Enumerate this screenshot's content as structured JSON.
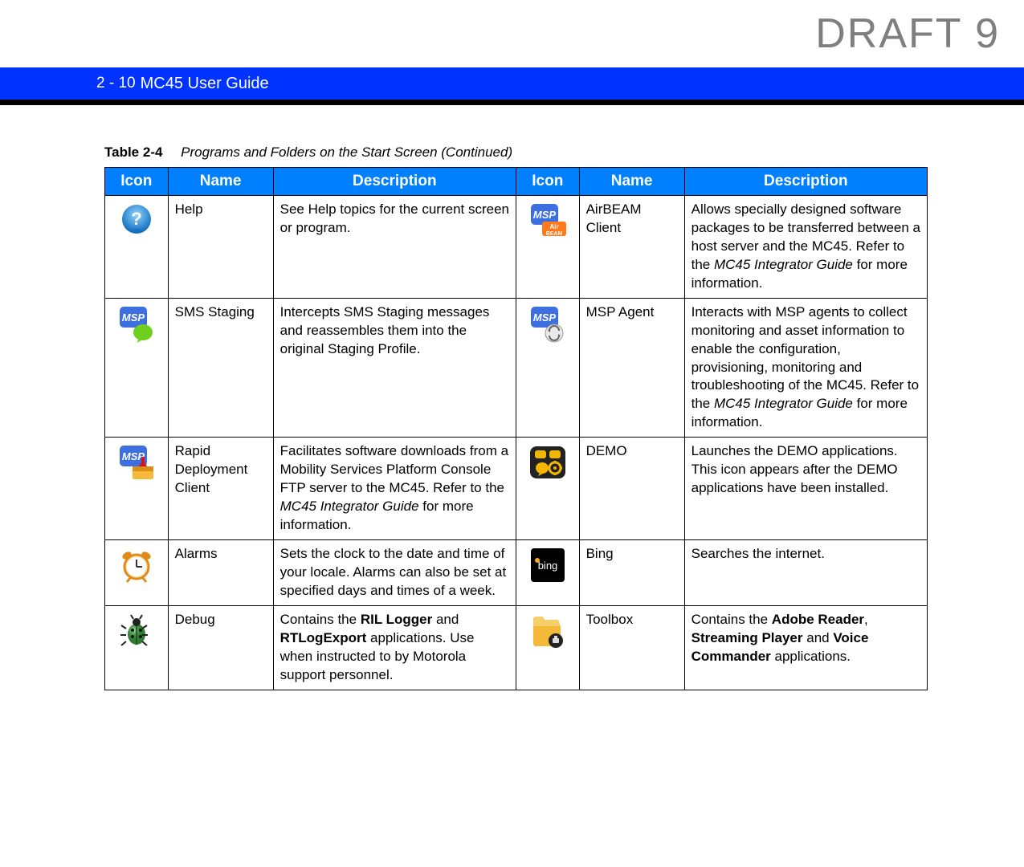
{
  "watermark": "DRAFT 9",
  "header": {
    "page_num": "2 - 10",
    "title": "MC45 User Guide"
  },
  "table_caption": {
    "label": "Table 2-4",
    "text": "Programs and Folders on the Start Screen (Continued)"
  },
  "th": {
    "icon": "Icon",
    "name": "Name",
    "desc": "Description"
  },
  "rows": [
    {
      "l_name": "Help",
      "l_desc": "See Help topics for the current screen or program.",
      "r_name": "AirBEAM Client",
      "r_desc_pre": "Allows specially designed software packages to be transferred between a host server and the MC45. Refer to the ",
      "r_desc_em": "MC45 Integrator Guide",
      "r_desc_post": " for more information."
    },
    {
      "l_name": "SMS Staging",
      "l_desc": "Intercepts SMS Staging messages and reassembles them into the original Staging Profile.",
      "r_name": "MSP Agent",
      "r_desc_pre": "Interacts with MSP agents to collect monitoring and asset information to enable the configuration, provisioning, monitoring and troubleshooting of the MC45. Refer to the ",
      "r_desc_em": "MC45 Integrator Guide",
      "r_desc_post": " for more information."
    },
    {
      "l_name": "Rapid Deployment Client",
      "l_desc_pre": "Facilitates software downloads from a Mobility Services Platform Console FTP server to the MC45. Refer to the ",
      "l_desc_em": "MC45 Integrator Guide",
      "l_desc_post": " for more information.",
      "r_name": "DEMO",
      "r_desc": "Launches the DEMO applications. This icon appears after the DEMO applications have been installed."
    },
    {
      "l_name": "Alarms",
      "l_desc": "Sets the clock to the date and time of your locale. Alarms can also be set at specified days and times of a week.",
      "r_name": "Bing",
      "r_desc": "Searches the internet."
    },
    {
      "l_name": "Debug",
      "l_desc_pre": "Contains the ",
      "l_desc_b1": "RIL Logger",
      "l_desc_mid1": " and ",
      "l_desc_b2": "RTLogExport",
      "l_desc_mid2": " applications. Use when instructed to by Motorola support personnel.",
      "r_name": "Toolbox",
      "r_desc_pre": "Contains the ",
      "r_desc_b1": "Adobe Reader",
      "r_desc_mid1": ", ",
      "r_desc_b2": "Streaming Player",
      "r_desc_mid2": " and ",
      "r_desc_b3": "Voice Commander",
      "r_desc_post": " applications."
    }
  ]
}
